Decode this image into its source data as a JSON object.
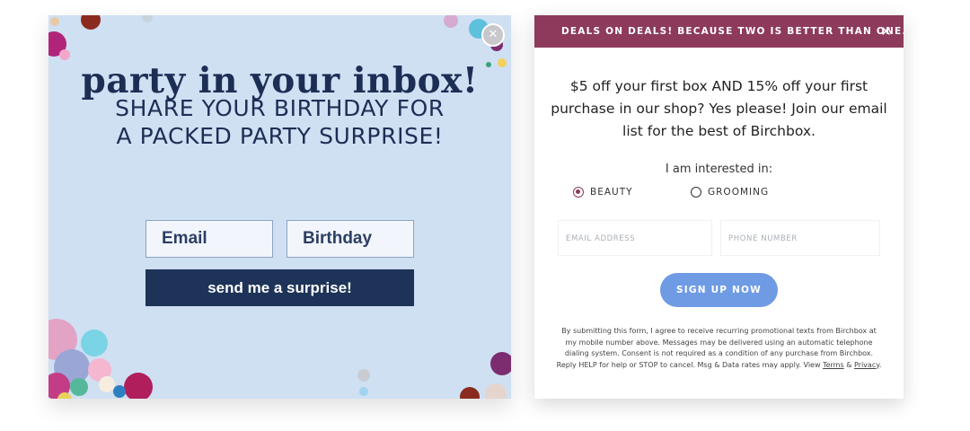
{
  "left_popup": {
    "title": "party in your inbox!",
    "subtitle_line1": "SHARE YOUR BIRTHDAY FOR",
    "subtitle_line2": "A PACKED PARTY SURPRISE!",
    "close_symbol": "✕",
    "email_placeholder": "Email",
    "birthday_placeholder": "Birthday",
    "submit_label": "send me a surprise!",
    "colors": {
      "background": "#cfe0f3",
      "text": "#1d2e55",
      "button": "#1d3358"
    },
    "decoration_icon": "confetti"
  },
  "right_popup": {
    "banner_text": "DEALS ON DEALS! BECAUSE TWO IS BETTER THAN ONE...",
    "banner_close_symbol": "✕",
    "offer_text": "$5 off your first box AND 15% off your first purchase in our shop? Yes please! Join our email list for the best of Birchbox.",
    "interest_label": "I am interested in:",
    "options": [
      {
        "label": "BEAUTY",
        "selected": true
      },
      {
        "label": "GROOMING",
        "selected": false
      }
    ],
    "email_placeholder": "EMAIL ADDRESS",
    "phone_placeholder": "PHONE NUMBER",
    "signup_label": "SIGN UP NOW",
    "legal_text": "By submitting this form, I agree to receive recurring promotional texts from Birchbox at my mobile number above. Messages may be delivered using an automatic telephone dialing system. Consent is not required as a condition of any purchase from Birchbox. Reply HELP for help or STOP to cancel. Msg & Data rates may apply. View",
    "terms_label": "Terms",
    "amp": "&",
    "privacy_label": "Privacy",
    "period": ".",
    "colors": {
      "banner": "#8d3a5c",
      "signup_button": "#6f9be5",
      "radio_selected": "#8d3a5c"
    }
  }
}
